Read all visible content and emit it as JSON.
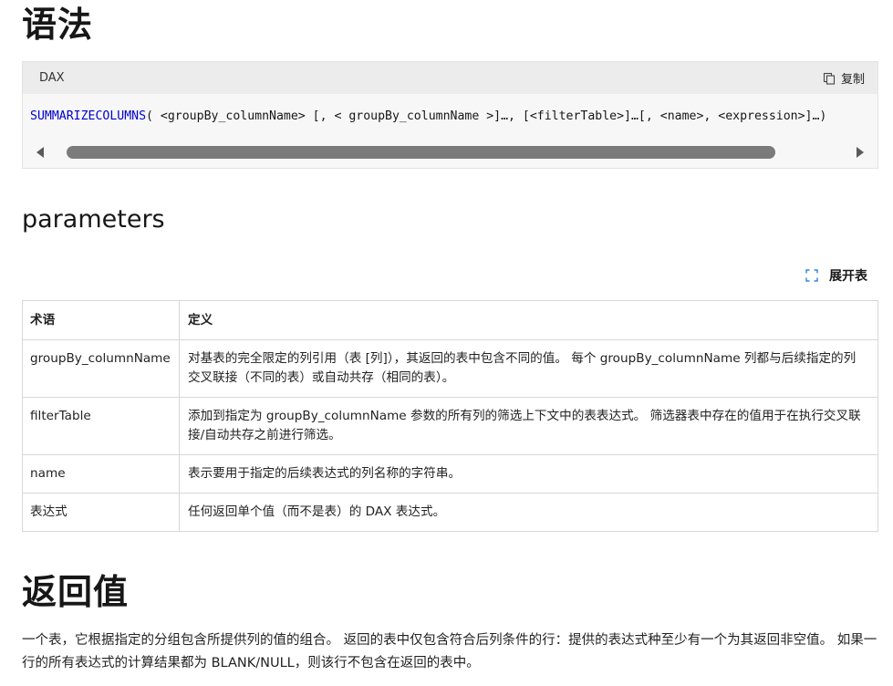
{
  "syntax": {
    "heading": "语法",
    "lang_label": "DAX",
    "copy_label": "复制",
    "code_func": "SUMMARIZECOLUMNS",
    "code_rest": "( <groupBy_columnName> [, < groupBy_columnName >]…, [<filterTable>]…[, <name>, <expression>]…)",
    "scroll_percent": 92
  },
  "parameters": {
    "heading": "parameters",
    "expand_label": "展开表",
    "columns": [
      "术语",
      "定义"
    ],
    "rows": [
      {
        "term": "groupBy_columnName",
        "definition": "对基表的完全限定的列引用（表 [列]），其返回的表中包含不同的值。 每个 groupBy_columnName 列都与后续指定的列交叉联接（不同的表）或自动共存（相同的表）。"
      },
      {
        "term": "filterTable",
        "definition": "添加到指定为 groupBy_columnName 参数的所有列的筛选上下文中的表表达式。 筛选器表中存在的值用于在执行交叉联接/自动共存之前进行筛选。"
      },
      {
        "term": "name",
        "definition": "表示要用于指定的后续表达式的列名称的字符串。"
      },
      {
        "term": "表达式",
        "definition": "任何返回单个值（而不是表）的 DAX 表达式。"
      }
    ]
  },
  "return_value": {
    "heading": "返回值",
    "text": "一个表，它根据指定的分组包含所提供列的值的组合。 返回的表中仅包含符合后列条件的行：提供的表达式种至少有一个为其返回非空值。 如果一行的所有表达式的计算结果都为 BLANK/NULL，则该行不包含在返回的表中。"
  }
}
